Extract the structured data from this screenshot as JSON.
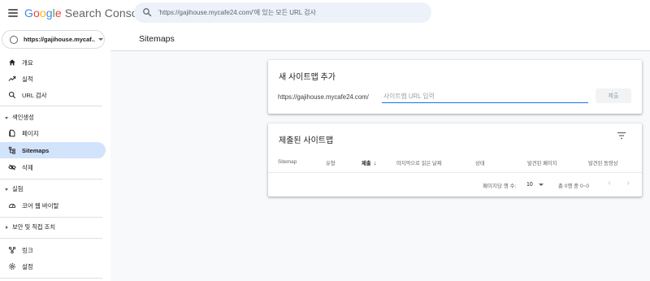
{
  "header": {
    "logo": {
      "google": "Google",
      "product": "Search Console"
    },
    "search_placeholder": "'https://gajihouse.mycafe24.com/'에 있는 모든 URL 검사"
  },
  "sidebar": {
    "property_label": "https://gajihouse.mycaf...",
    "items": {
      "overview": "개요",
      "performance": "실적",
      "url_inspection": "URL 검사",
      "indexing_section": "색인생성",
      "pages": "페이지",
      "sitemaps": "Sitemaps",
      "removals": "삭제",
      "experience_section": "실험",
      "core_web_vitals": "코어 웹 바이탈",
      "security_section": "보안 및 직접 조치",
      "links": "링크",
      "settings": "설정"
    }
  },
  "main": {
    "page_title": "Sitemaps",
    "add_card": {
      "title": "새 사이트맵 추가",
      "url_prefix": "https://gajihouse.mycafe24.com/",
      "input_placeholder": "사이트맵 URL 입력",
      "submit_label": "제출"
    },
    "submitted_card": {
      "title": "제출된 사이트맵",
      "columns": [
        "Sitemap",
        "유형",
        "제출",
        "마지막으로 읽은 날짜",
        "상태",
        "발견된 페이지",
        "발견된 동영상"
      ],
      "sort_arrow": "↓",
      "rows_per_page_label": "페이지당 행 수:",
      "rows_per_page_value": "10",
      "range_label": "총 0행 중 0~0",
      "prev": "‹",
      "next": "›"
    }
  },
  "colors": {
    "active_nav": "#d2e3fc",
    "accent": "#1a73e8",
    "search_bg": "#edf2fa"
  }
}
